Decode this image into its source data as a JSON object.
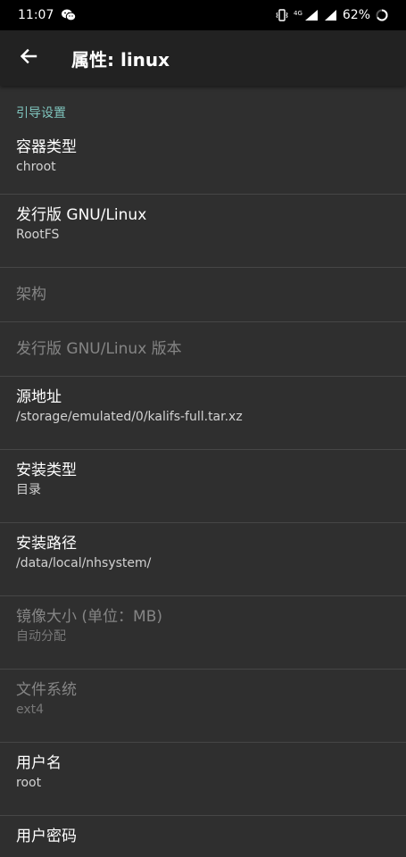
{
  "status_bar": {
    "time": "11:07",
    "network": "4G",
    "battery": "62%",
    "icons": [
      "wechat-icon",
      "vibrate-icon",
      "signal-icon",
      "battery-icon"
    ]
  },
  "app_bar": {
    "title": "属性: linux",
    "back_icon": "arrow-back-icon"
  },
  "section": {
    "header": "引导设置"
  },
  "prefs": [
    {
      "title": "容器类型",
      "summary": "chroot",
      "enabled": true
    },
    {
      "title": "发行版 GNU/Linux",
      "summary": "RootFS",
      "enabled": true
    },
    {
      "title": "架构",
      "summary": "",
      "enabled": false
    },
    {
      "title": "发行版 GNU/Linux 版本",
      "summary": "",
      "enabled": false
    },
    {
      "title": "源地址",
      "summary": "/storage/emulated/0/kalifs-full.tar.xz",
      "enabled": true
    },
    {
      "title": "安装类型",
      "summary": "目录",
      "enabled": true
    },
    {
      "title": "安装路径",
      "summary": "/data/local/nhsystem/",
      "enabled": true
    },
    {
      "title": "镜像大小 (单位：MB)",
      "summary": "自动分配",
      "enabled": false
    },
    {
      "title": "文件系统",
      "summary": "ext4",
      "enabled": false
    },
    {
      "title": "用户名",
      "summary": "root",
      "enabled": true
    },
    {
      "title": "用户密码",
      "summary": "",
      "enabled": true
    }
  ],
  "colors": {
    "background": "#2f2f2f",
    "app_bar": "#222222",
    "status_bar": "#000000",
    "accent": "#7fc4bd",
    "divider": "#464646"
  }
}
